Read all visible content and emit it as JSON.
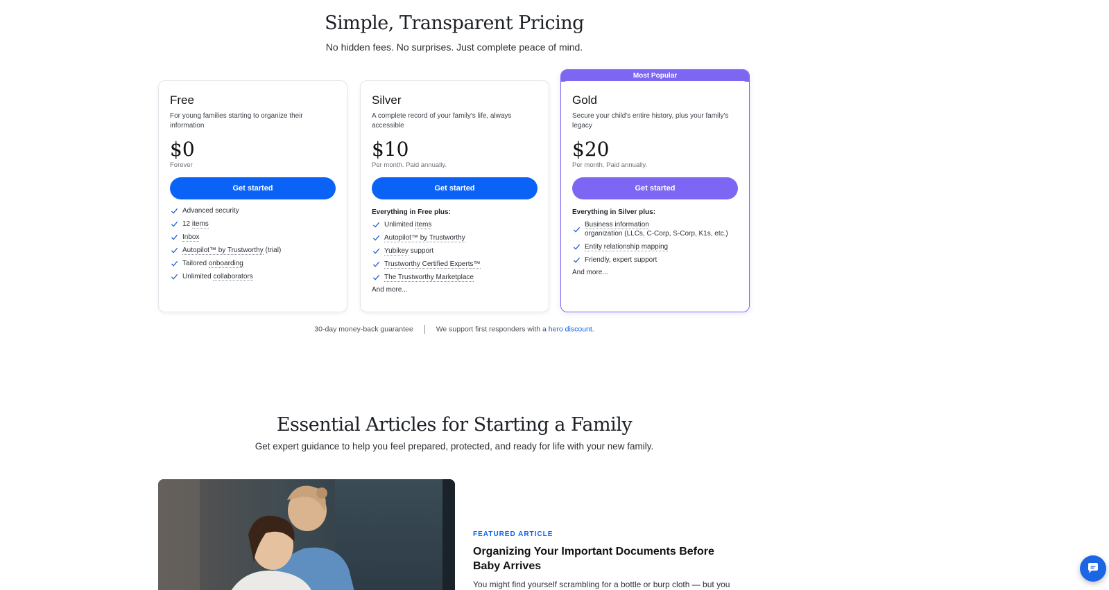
{
  "pricing": {
    "title": "Simple, Transparent Pricing",
    "subtitle": "No hidden fees. No surprises. Just complete peace of mind."
  },
  "plans": [
    {
      "name": "Free",
      "description": "For young families starting to organize their information",
      "price": "$0",
      "period": "Forever",
      "cta": "Get started",
      "features": [
        {
          "pre": "",
          "link": "",
          "post": "Advanced security"
        },
        {
          "pre": "12 ",
          "link": "items",
          "post": ""
        },
        {
          "pre": "",
          "link": "Inbox",
          "post": ""
        },
        {
          "pre": "",
          "link": "Autopilot™ by Trustworthy",
          "post": " (trial)"
        },
        {
          "pre": "Tailored ",
          "link": "onboarding",
          "post": ""
        },
        {
          "pre": "Unlimited ",
          "link": "collaborators",
          "post": ""
        }
      ]
    },
    {
      "name": "Silver",
      "description": "A complete record of your family's life, always accessible",
      "price": "$10",
      "period": "Per month. Paid annually.",
      "cta": "Get started",
      "includes": "Everything in Free plus:",
      "features": [
        {
          "pre": "Unlimited ",
          "link": "items",
          "post": ""
        },
        {
          "pre": "",
          "link": "Autopilot™ by Trustworthy",
          "post": ""
        },
        {
          "pre": "",
          "link": "Yubikey",
          "post": " support"
        },
        {
          "pre": "",
          "link": "Trustworthy Certified Experts™",
          "post": ""
        },
        {
          "pre": "",
          "link": "The Trustworthy Marketplace",
          "post": ""
        }
      ],
      "more": "And more..."
    },
    {
      "name": "Gold",
      "badge": "Most Popular",
      "description": "Secure your child's entire history, plus your family's legacy",
      "price": "$20",
      "period": "Per month. Paid annually.",
      "cta": "Get started",
      "includes": "Everything in Silver plus:",
      "features": [
        {
          "link": "Business information",
          "line2": "organization (LLCs, C-Corp, S-Corp, K1s, etc.)"
        },
        {
          "link": "Entity relationship mapping",
          "post": ""
        },
        {
          "link": "",
          "post": "Friendly, expert support"
        }
      ],
      "more": "And more..."
    }
  ],
  "guarantee": {
    "money_back": "30-day money-back guarantee",
    "responders": "We support first responders with a ",
    "discount_link": "hero discount."
  },
  "articles": {
    "title": "Essential Articles for Starting a Family",
    "subtitle": "Get expert guidance to help you feel prepared, protected, and ready for life with your new family.",
    "featured_label": "FEATURED ARTICLE",
    "featured_title": "Organizing Your Important Documents Before Baby Arrives",
    "featured_excerpt": "You might find yourself scrambling for a bottle or burp cloth — but you"
  },
  "colors": {
    "primary_blue": "#0a63f6",
    "gold_purple": "#7c66f2"
  },
  "icons": {
    "check": "check-icon",
    "chat": "chat-icon"
  }
}
